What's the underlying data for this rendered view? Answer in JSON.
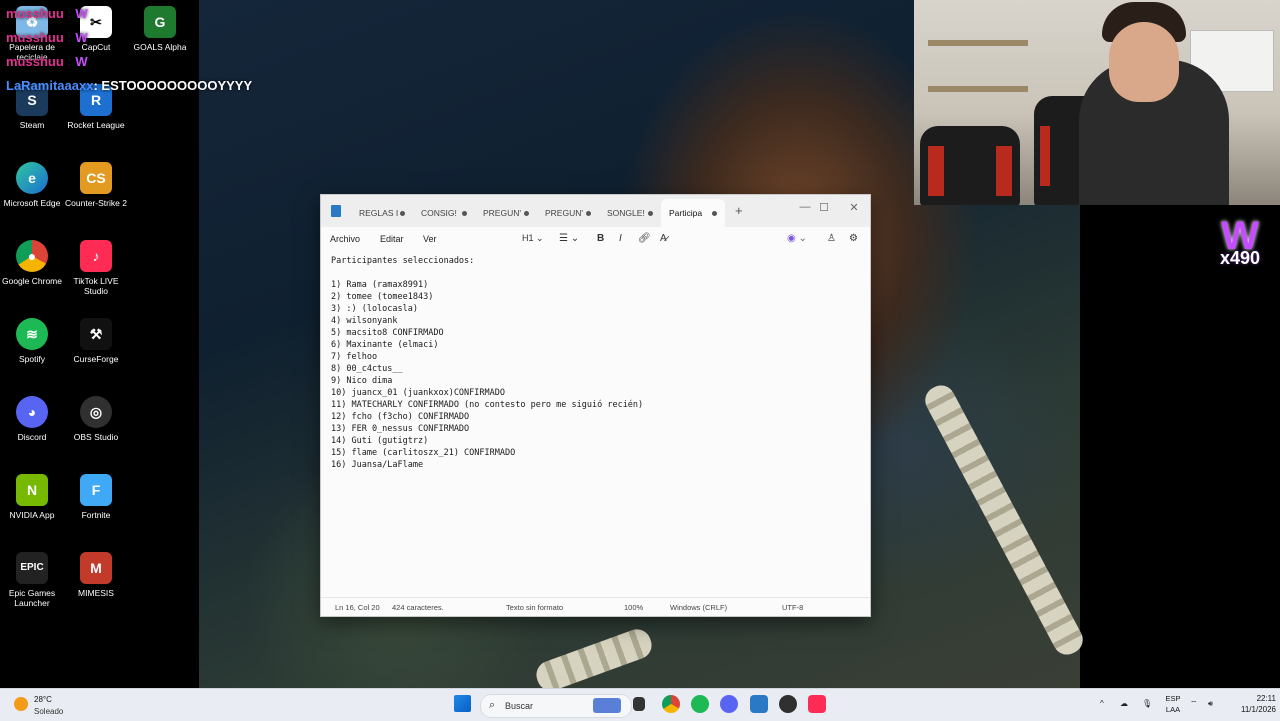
{
  "chat": [
    {
      "user": "musshuu",
      "badge": "W",
      "msg": ""
    },
    {
      "user": "musshuu",
      "badge": "W",
      "msg": ""
    },
    {
      "user": "musshuu",
      "badge": "W",
      "msg": ""
    },
    {
      "user": "LaRamitaaaxx",
      "badge": "",
      "msg": ": ESTOOOOOOOOOYYYY"
    }
  ],
  "desktop_icons": [
    {
      "label": "Papelera de reciclaje",
      "icon": "recycle-bin-icon"
    },
    {
      "label": "CapCut",
      "icon": "capcut-icon"
    },
    {
      "label": "GOALS Alpha",
      "icon": "goals-icon"
    },
    {
      "label": "Steam",
      "icon": "steam-icon"
    },
    {
      "label": "Rocket League",
      "icon": "rocket-league-icon"
    },
    {
      "label": "Microsoft Edge",
      "icon": "edge-icon"
    },
    {
      "label": "Counter-Strike 2",
      "icon": "cs2-icon"
    },
    {
      "label": "Google Chrome",
      "icon": "chrome-icon"
    },
    {
      "label": "TikTok LIVE Studio",
      "icon": "tiktok-icon"
    },
    {
      "label": "Spotify",
      "icon": "spotify-icon"
    },
    {
      "label": "CurseForge",
      "icon": "curseforge-icon"
    },
    {
      "label": "Discord",
      "icon": "discord-icon"
    },
    {
      "label": "OBS Studio",
      "icon": "obs-icon"
    },
    {
      "label": "NVIDIA App",
      "icon": "nvidia-icon"
    },
    {
      "label": "Fortnite",
      "icon": "fortnite-icon"
    },
    {
      "label": "Epic Games Launcher",
      "icon": "epic-icon"
    },
    {
      "label": "MIMESIS",
      "icon": "mimesis-icon"
    }
  ],
  "overlay": {
    "multiplier": "x490"
  },
  "notepad": {
    "tabs": [
      {
        "label": "REGLAS I",
        "active": false
      },
      {
        "label": "CONSIG!",
        "active": false
      },
      {
        "label": "PREGUN'",
        "active": false
      },
      {
        "label": "PREGUN'",
        "active": false
      },
      {
        "label": "SONGLE!",
        "active": false
      },
      {
        "label": "Participa",
        "active": true
      }
    ],
    "menus": {
      "file": "Archivo",
      "edit": "Editar",
      "view": "Ver"
    },
    "toolbar": {
      "heading": "H1",
      "bold": "B",
      "italic": "I"
    },
    "lines": [
      "Participantes seleccionados:",
      "",
      "1) Rama (ramax8991)",
      "2) tomee (tomee1843)",
      "3) :) (lolocasla)",
      "4) wilsonyank",
      "5) macsito8 CONFIRMADO",
      "6) Maxinante (elmaci)",
      "7) felhoo",
      "8) 00_c4ctus__",
      "9) Nico dima",
      "10) juancx_01 (juankxox)CONFIRMADO",
      "11) MATECHARLY CONFIRMADO (no contesto pero me siguió recién)",
      "12) fcho (f3cho) CONFIRMADO",
      "13) FER 0_nessus CONFIRMADO",
      "14) Guti (gutigtrz)",
      "15) flame (carlitoszx_21) CONFIRMADO",
      "16) Juansa/LaFlame"
    ],
    "status": {
      "position": "Ln 16, Col 20",
      "chars": "424 caracteres.",
      "format": "Texto sin formato",
      "zoom": "100%",
      "eol": "Windows (CRLF)",
      "encoding": "UTF-8"
    }
  },
  "taskbar": {
    "weather": {
      "temp": "28°C",
      "condition": "Soleado"
    },
    "search_placeholder": "Buscar",
    "lang": {
      "line1": "ESP",
      "line2": "LAA"
    },
    "time": "22:11",
    "date": "11/1/2026"
  }
}
